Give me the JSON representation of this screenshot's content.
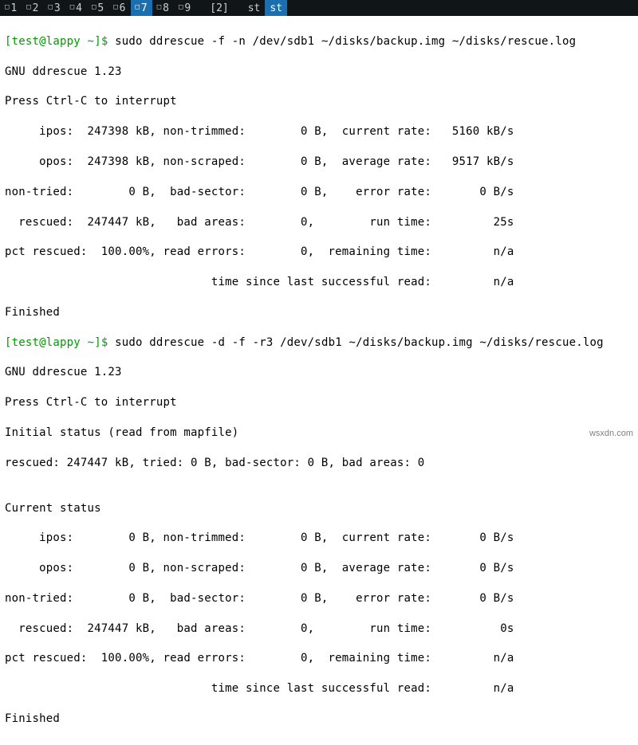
{
  "tabs": {
    "items": [
      {
        "corner": "□",
        "label": "1"
      },
      {
        "corner": "□",
        "label": "2"
      },
      {
        "corner": "□",
        "label": "3"
      },
      {
        "corner": "□",
        "label": "4"
      },
      {
        "corner": "□",
        "label": "5"
      },
      {
        "corner": "□",
        "label": "6"
      },
      {
        "corner": "□",
        "label": "7"
      },
      {
        "corner": "□",
        "label": "8"
      },
      {
        "corner": "□",
        "label": "9"
      },
      {
        "corner": "",
        "label": "[2]"
      },
      {
        "corner": "",
        "label": "st"
      },
      {
        "corner": "",
        "label": "st"
      }
    ],
    "active_index": 6,
    "last_active_index": 11
  },
  "prompt1": {
    "user": "[test@lappy ",
    "path": "~",
    "end": "]$ ",
    "cmd": "sudo ddrescue -f -n /dev/sdb1 ~/disks/backup.img ~/disks/rescue.log"
  },
  "output1": {
    "l1": "GNU ddrescue 1.23",
    "l2": "Press Ctrl-C to interrupt",
    "l3": "     ipos:  247398 kB, non-trimmed:        0 B,  current rate:   5160 kB/s",
    "l4": "     opos:  247398 kB, non-scraped:        0 B,  average rate:   9517 kB/s",
    "l5": "non-tried:        0 B,  bad-sector:        0 B,    error rate:       0 B/s",
    "l6": "  rescued:  247447 kB,   bad areas:        0,        run time:         25s",
    "l7": "pct rescued:  100.00%, read errors:        0,  remaining time:         n/a",
    "l8": "                              time since last successful read:         n/a",
    "l9": "Finished"
  },
  "prompt2": {
    "user": "[test@lappy ",
    "path": "~",
    "end": "]$ ",
    "cmd": "sudo ddrescue -d -f -r3 /dev/sdb1 ~/disks/backup.img ~/disks/rescue.log"
  },
  "output2": {
    "l1": "GNU ddrescue 1.23",
    "l2": "Press Ctrl-C to interrupt",
    "l3": "Initial status (read from mapfile)",
    "l4": "rescued: 247447 kB, tried: 0 B, bad-sector: 0 B, bad areas: 0",
    "l5": "",
    "l6": "Current status",
    "l7": "     ipos:        0 B, non-trimmed:        0 B,  current rate:       0 B/s",
    "l8": "     opos:        0 B, non-scraped:        0 B,  average rate:       0 B/s",
    "l9": "non-tried:        0 B,  bad-sector:        0 B,    error rate:       0 B/s",
    "l10": "  rescued:  247447 kB,   bad areas:        0,        run time:          0s",
    "l11": "pct rescued:  100.00%, read errors:        0,  remaining time:         n/a",
    "l12": "                              time since last successful read:         n/a",
    "l13": "Finished"
  },
  "watermark": "wsxdn.com"
}
